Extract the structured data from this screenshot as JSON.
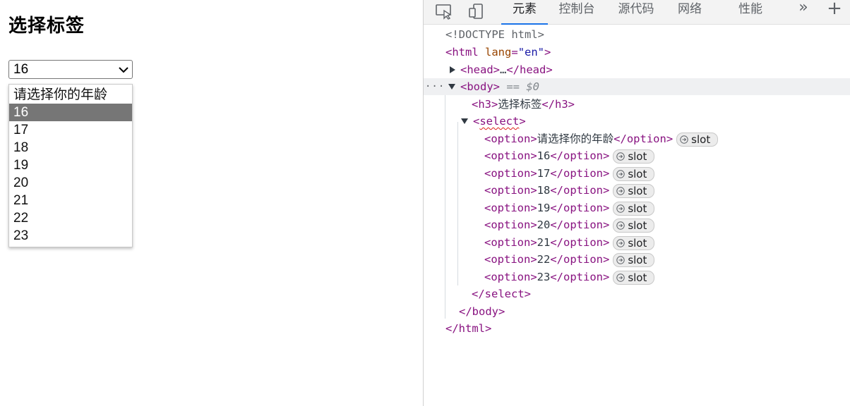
{
  "page": {
    "title": "选择标签",
    "select": {
      "value": "16",
      "options": [
        "请选择你的年龄",
        "16",
        "17",
        "18",
        "19",
        "20",
        "21",
        "22",
        "23"
      ],
      "selected_index": 1
    }
  },
  "devtools": {
    "tabs": [
      {
        "label": "元素",
        "active": true
      },
      {
        "label": "控制台",
        "active": false
      },
      {
        "label": "源代码",
        "active": false
      },
      {
        "label": "网络",
        "active": false
      },
      {
        "label": "性能",
        "active": false
      }
    ],
    "more_tabs_label": "»",
    "add_tab_label": "+",
    "tree": {
      "doctype": "<!DOCTYPE html>",
      "html_open_tag": "html",
      "html_attr_name": "lang",
      "html_attr_value": "\"en\"",
      "head_open": "<head>",
      "head_ellipsis": "…",
      "head_close": "</head>",
      "body_open": "<body>",
      "body_hint": "== $0",
      "h3_open": "<h3>",
      "h3_text": "选择标签",
      "h3_close": "</h3>",
      "select_open_tag": "select",
      "option_open": "<option>",
      "option_close": "</option>",
      "options": [
        "请选择你的年龄",
        "16",
        "17",
        "18",
        "19",
        "20",
        "21",
        "22",
        "23"
      ],
      "slot_label": "slot",
      "select_close": "</select>",
      "body_close": "</body>",
      "html_close": "</html>",
      "ellipsis_marker": "···"
    }
  },
  "colors": {
    "selected_option_bg": "#767676",
    "active_tab_underline": "#1a73e8",
    "tag_color": "#881280",
    "attr_name_color": "#994500",
    "attr_value_color": "#1a1aa6"
  }
}
